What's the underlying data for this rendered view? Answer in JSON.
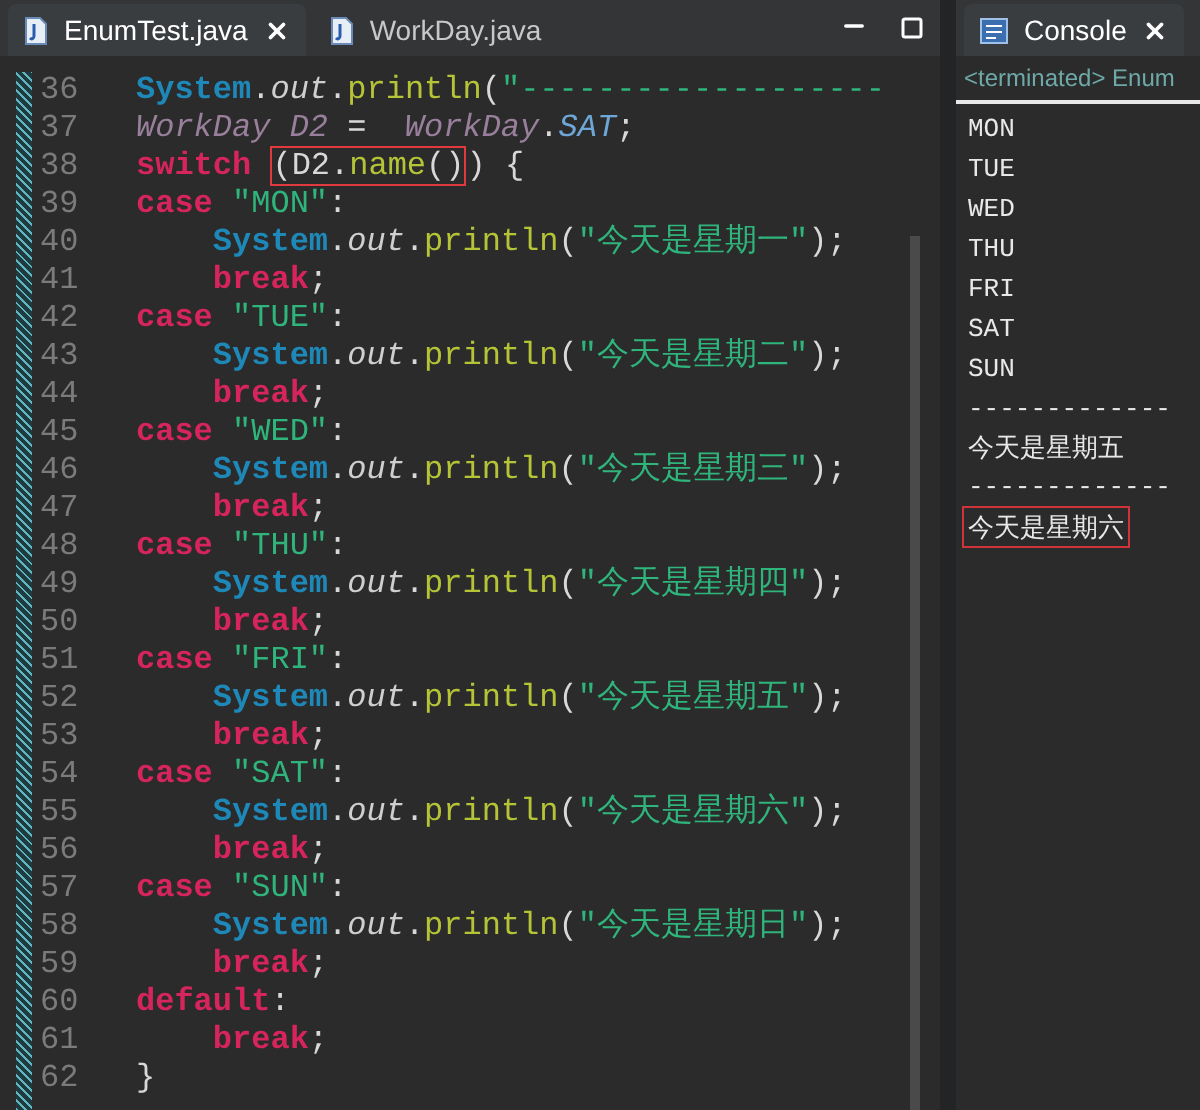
{
  "editor": {
    "tabs": [
      {
        "label": "EnumTest.java",
        "selected": true,
        "closable": true
      },
      {
        "label": "WorkDay.java",
        "selected": false,
        "closable": false
      }
    ],
    "lines": [
      {
        "number": "36",
        "tokens": [
          {
            "kind": "type",
            "text": "System"
          },
          {
            "kind": "plain",
            "text": "."
          },
          {
            "kind": "field",
            "text": "out"
          },
          {
            "kind": "plain",
            "text": "."
          },
          {
            "kind": "method",
            "text": "println"
          },
          {
            "kind": "plain",
            "text": "("
          },
          {
            "kind": "string",
            "text": "\"-------------------"
          }
        ]
      },
      {
        "number": "37",
        "tokens": [
          {
            "kind": "local",
            "text": "WorkDay D2"
          },
          {
            "kind": "plain",
            "text": " =  "
          },
          {
            "kind": "local",
            "text": "WorkDay"
          },
          {
            "kind": "plain",
            "text": "."
          },
          {
            "kind": "static",
            "text": "SAT"
          },
          {
            "kind": "plain",
            "text": ";"
          }
        ]
      },
      {
        "number": "38",
        "tokens": [
          {
            "kind": "keyword",
            "text": "switch "
          },
          {
            "kind": "group",
            "boxed": true,
            "tokens": [
              {
                "kind": "plain",
                "text": "(D2."
              },
              {
                "kind": "method",
                "text": "name"
              },
              {
                "kind": "plain",
                "text": "()"
              }
            ]
          },
          {
            "kind": "plain",
            "text": ") {"
          }
        ]
      },
      {
        "number": "39",
        "tokens": [
          {
            "kind": "keyword",
            "text": "case "
          },
          {
            "kind": "string",
            "text": "\"MON\""
          },
          {
            "kind": "plain",
            "text": ":"
          }
        ]
      },
      {
        "number": "40",
        "tokens": [
          {
            "kind": "type",
            "text": "    System"
          },
          {
            "kind": "plain",
            "text": "."
          },
          {
            "kind": "field",
            "text": "out"
          },
          {
            "kind": "plain",
            "text": "."
          },
          {
            "kind": "method",
            "text": "println"
          },
          {
            "kind": "plain",
            "text": "("
          },
          {
            "kind": "string",
            "text": "\"今天是星期一\""
          },
          {
            "kind": "plain",
            "text": ");"
          }
        ]
      },
      {
        "number": "41",
        "tokens": [
          {
            "kind": "keyword",
            "text": "    break"
          },
          {
            "kind": "plain",
            "text": ";"
          }
        ]
      },
      {
        "number": "42",
        "tokens": [
          {
            "kind": "keyword",
            "text": "case "
          },
          {
            "kind": "string",
            "text": "\"TUE\""
          },
          {
            "kind": "plain",
            "text": ":"
          }
        ]
      },
      {
        "number": "43",
        "tokens": [
          {
            "kind": "type",
            "text": "    System"
          },
          {
            "kind": "plain",
            "text": "."
          },
          {
            "kind": "field",
            "text": "out"
          },
          {
            "kind": "plain",
            "text": "."
          },
          {
            "kind": "method",
            "text": "println"
          },
          {
            "kind": "plain",
            "text": "("
          },
          {
            "kind": "string",
            "text": "\"今天是星期二\""
          },
          {
            "kind": "plain",
            "text": ");"
          }
        ]
      },
      {
        "number": "44",
        "tokens": [
          {
            "kind": "keyword",
            "text": "    break"
          },
          {
            "kind": "plain",
            "text": ";"
          }
        ]
      },
      {
        "number": "45",
        "tokens": [
          {
            "kind": "keyword",
            "text": "case "
          },
          {
            "kind": "string",
            "text": "\"WED\""
          },
          {
            "kind": "plain",
            "text": ":"
          }
        ]
      },
      {
        "number": "46",
        "tokens": [
          {
            "kind": "type",
            "text": "    System"
          },
          {
            "kind": "plain",
            "text": "."
          },
          {
            "kind": "field",
            "text": "out"
          },
          {
            "kind": "plain",
            "text": "."
          },
          {
            "kind": "method",
            "text": "println"
          },
          {
            "kind": "plain",
            "text": "("
          },
          {
            "kind": "string",
            "text": "\"今天是星期三\""
          },
          {
            "kind": "plain",
            "text": ");"
          }
        ]
      },
      {
        "number": "47",
        "tokens": [
          {
            "kind": "keyword",
            "text": "    break"
          },
          {
            "kind": "plain",
            "text": ";"
          }
        ]
      },
      {
        "number": "48",
        "tokens": [
          {
            "kind": "keyword",
            "text": "case "
          },
          {
            "kind": "string",
            "text": "\"THU\""
          },
          {
            "kind": "plain",
            "text": ":"
          }
        ]
      },
      {
        "number": "49",
        "tokens": [
          {
            "kind": "type",
            "text": "    System"
          },
          {
            "kind": "plain",
            "text": "."
          },
          {
            "kind": "field",
            "text": "out"
          },
          {
            "kind": "plain",
            "text": "."
          },
          {
            "kind": "method",
            "text": "println"
          },
          {
            "kind": "plain",
            "text": "("
          },
          {
            "kind": "string",
            "text": "\"今天是星期四\""
          },
          {
            "kind": "plain",
            "text": ");"
          }
        ]
      },
      {
        "number": "50",
        "tokens": [
          {
            "kind": "keyword",
            "text": "    break"
          },
          {
            "kind": "plain",
            "text": ";"
          }
        ]
      },
      {
        "number": "51",
        "tokens": [
          {
            "kind": "keyword",
            "text": "case "
          },
          {
            "kind": "string",
            "text": "\"FRI\""
          },
          {
            "kind": "plain",
            "text": ":"
          }
        ]
      },
      {
        "number": "52",
        "tokens": [
          {
            "kind": "type",
            "text": "    System"
          },
          {
            "kind": "plain",
            "text": "."
          },
          {
            "kind": "field",
            "text": "out"
          },
          {
            "kind": "plain",
            "text": "."
          },
          {
            "kind": "method",
            "text": "println"
          },
          {
            "kind": "plain",
            "text": "("
          },
          {
            "kind": "string",
            "text": "\"今天是星期五\""
          },
          {
            "kind": "plain",
            "text": ");"
          }
        ]
      },
      {
        "number": "53",
        "tokens": [
          {
            "kind": "keyword",
            "text": "    break"
          },
          {
            "kind": "plain",
            "text": ";"
          }
        ]
      },
      {
        "number": "54",
        "tokens": [
          {
            "kind": "keyword",
            "text": "case "
          },
          {
            "kind": "string",
            "text": "\"SAT\""
          },
          {
            "kind": "plain",
            "text": ":"
          }
        ]
      },
      {
        "number": "55",
        "tokens": [
          {
            "kind": "type",
            "text": "    System"
          },
          {
            "kind": "plain",
            "text": "."
          },
          {
            "kind": "field",
            "text": "out"
          },
          {
            "kind": "plain",
            "text": "."
          },
          {
            "kind": "method",
            "text": "println"
          },
          {
            "kind": "plain",
            "text": "("
          },
          {
            "kind": "string",
            "text": "\"今天是星期六\""
          },
          {
            "kind": "plain",
            "text": ");"
          }
        ]
      },
      {
        "number": "56",
        "tokens": [
          {
            "kind": "keyword",
            "text": "    break"
          },
          {
            "kind": "plain",
            "text": ";"
          }
        ]
      },
      {
        "number": "57",
        "tokens": [
          {
            "kind": "keyword",
            "text": "case "
          },
          {
            "kind": "string",
            "text": "\"SUN\""
          },
          {
            "kind": "plain",
            "text": ":"
          }
        ]
      },
      {
        "number": "58",
        "tokens": [
          {
            "kind": "type",
            "text": "    System"
          },
          {
            "kind": "plain",
            "text": "."
          },
          {
            "kind": "field",
            "text": "out"
          },
          {
            "kind": "plain",
            "text": "."
          },
          {
            "kind": "method",
            "text": "println"
          },
          {
            "kind": "plain",
            "text": "("
          },
          {
            "kind": "string",
            "text": "\"今天是星期日\""
          },
          {
            "kind": "plain",
            "text": ");"
          }
        ]
      },
      {
        "number": "59",
        "tokens": [
          {
            "kind": "keyword",
            "text": "    break"
          },
          {
            "kind": "plain",
            "text": ";"
          }
        ]
      },
      {
        "number": "60",
        "tokens": [
          {
            "kind": "keyword",
            "text": "default"
          },
          {
            "kind": "plain",
            "text": ":"
          }
        ]
      },
      {
        "number": "61",
        "tokens": [
          {
            "kind": "keyword",
            "text": "    break"
          },
          {
            "kind": "plain",
            "text": ";"
          }
        ]
      },
      {
        "number": "62",
        "tokens": [
          {
            "kind": "plain",
            "text": "}"
          }
        ]
      }
    ]
  },
  "console": {
    "tab": {
      "label": "Console",
      "selected": true,
      "closable": true
    },
    "subtitle": "<terminated> Enum",
    "lines": [
      {
        "text": "MON",
        "boxed": false
      },
      {
        "text": "TUE",
        "boxed": false
      },
      {
        "text": "WED",
        "boxed": false
      },
      {
        "text": "THU",
        "boxed": false
      },
      {
        "text": "FRI",
        "boxed": false
      },
      {
        "text": "SAT",
        "boxed": false
      },
      {
        "text": "SUN",
        "boxed": false
      },
      {
        "text": "-------------",
        "boxed": false
      },
      {
        "text": "今天是星期五",
        "boxed": false
      },
      {
        "text": "-------------",
        "boxed": false
      },
      {
        "text": "今天是星期六",
        "boxed": true
      }
    ]
  }
}
